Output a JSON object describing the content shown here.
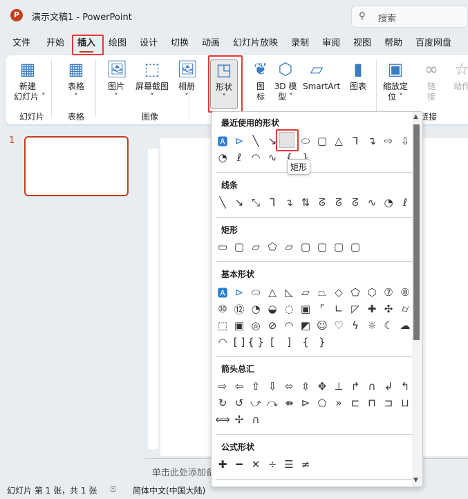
{
  "app": {
    "title": "演示文稿1  -  PowerPoint",
    "logo": "P",
    "search_placeholder": "搜索"
  },
  "tabs": [
    "文件",
    "开始",
    "插入",
    "绘图",
    "设计",
    "切换",
    "动画",
    "幻灯片放映",
    "录制",
    "审阅",
    "视图",
    "帮助",
    "百度网盘"
  ],
  "active_tab": "插入",
  "ribbon": {
    "buttons": [
      {
        "id": "new-slide",
        "label": "新建\n幻灯片 ˅",
        "icon": "new-slide-icon"
      },
      {
        "id": "table",
        "label": "表格\n˅",
        "icon": "table-icon"
      },
      {
        "id": "picture",
        "label": "图片\n˅",
        "icon": "picture-icon"
      },
      {
        "id": "screenshot",
        "label": "屏幕截图\n˅",
        "icon": "screenshot-icon"
      },
      {
        "id": "album",
        "label": "相册\n˅",
        "icon": "album-icon"
      },
      {
        "id": "shapes",
        "label": "形状\n˅",
        "icon": "shapes-icon"
      },
      {
        "id": "icons",
        "label": "图\n标",
        "icon": "icons-icon"
      },
      {
        "id": "3d-model",
        "label": "3D 模\n型 ˅",
        "icon": "cube-icon"
      },
      {
        "id": "smartart",
        "label": "SmartArt",
        "icon": "smartart-icon"
      },
      {
        "id": "chart",
        "label": "图表",
        "icon": "chart-icon"
      },
      {
        "id": "zoom",
        "label": "缩放定\n位 ˅",
        "icon": "zoom-icon"
      },
      {
        "id": "link",
        "label": "链\n接",
        "icon": "link-icon"
      },
      {
        "id": "action",
        "label": "动作",
        "icon": "star-icon"
      }
    ],
    "groups": [
      "幻灯片",
      "表格",
      "图像",
      "链接"
    ]
  },
  "slide_panel": {
    "number": "1"
  },
  "notes_placeholder": "单击此处添加备注",
  "status": {
    "slide_info": "幻灯片 第 1 张，共 1 张",
    "language": "简体中文(中国大陆)"
  },
  "gallery": {
    "tooltip": "矩形",
    "sections": [
      {
        "title": "最近使用的形状",
        "rows": [
          [
            "textbox",
            "vtextbox",
            "line",
            "arrow",
            "rect",
            "oval",
            "rrect",
            "tri",
            "elbow",
            "elbowarrow",
            "rarrow",
            "darrow"
          ],
          [
            "freeform",
            "scribble",
            "arc",
            "curve",
            "lbrace",
            "rbrace"
          ]
        ]
      },
      {
        "title": "线条",
        "rows": [
          [
            "line",
            "arrow",
            "dblarrow",
            "elbow",
            "elbowarrow",
            "elbowdbl",
            "curvedconn",
            "curvedarrow",
            "curveddbl",
            "curve",
            "freeform",
            "scribble"
          ]
        ]
      },
      {
        "title": "矩形",
        "rows": [
          [
            "rect",
            "rrect",
            "snip1",
            "snip2",
            "snipround",
            "round1",
            "round2",
            "roundd",
            "rrect"
          ]
        ]
      },
      {
        "title": "基本形状",
        "rows": [
          [
            "textbox",
            "vtextbox",
            "oval",
            "tri",
            "rtri",
            "para",
            "trap",
            "diamond",
            "pent",
            "hex",
            "hept",
            "oct"
          ],
          [
            "dec",
            "dodec",
            "pie",
            "chord",
            "tear",
            "frame",
            "halfframe",
            "lshape",
            "diag",
            "plus",
            "plaque",
            "can"
          ],
          [
            "cube",
            "bevel",
            "donut",
            "noentry",
            "bluarc",
            "fold",
            "smiley",
            "heart",
            "bolt",
            "sun",
            "moon",
            "cloud"
          ],
          [
            "arc",
            "bracketpair",
            "bracepair",
            "lbracket",
            "rbracket",
            "lbrace",
            "rbrace"
          ]
        ]
      },
      {
        "title": "箭头总汇",
        "rows": [
          [
            "rarrow",
            "larrow",
            "uarrow",
            "darrow",
            "lrarrow",
            "udarrow",
            "quadarrow",
            "lruarrow",
            "bentarrow",
            "uturn",
            "lupArrow",
            "bentup"
          ],
          [
            "curvedr",
            "curvedl",
            "curvedu",
            "curvedd",
            "striped",
            "notched",
            "pentarrow",
            "chevron",
            "rcallout",
            "dcallout",
            "lcallout",
            "ucallout"
          ],
          [
            "lrcallout",
            "quadcallout",
            "circular"
          ]
        ]
      },
      {
        "title": "公式形状",
        "rows": [
          [
            "plus",
            "minus",
            "mult",
            "div",
            "equal",
            "notequal"
          ]
        ]
      }
    ]
  }
}
